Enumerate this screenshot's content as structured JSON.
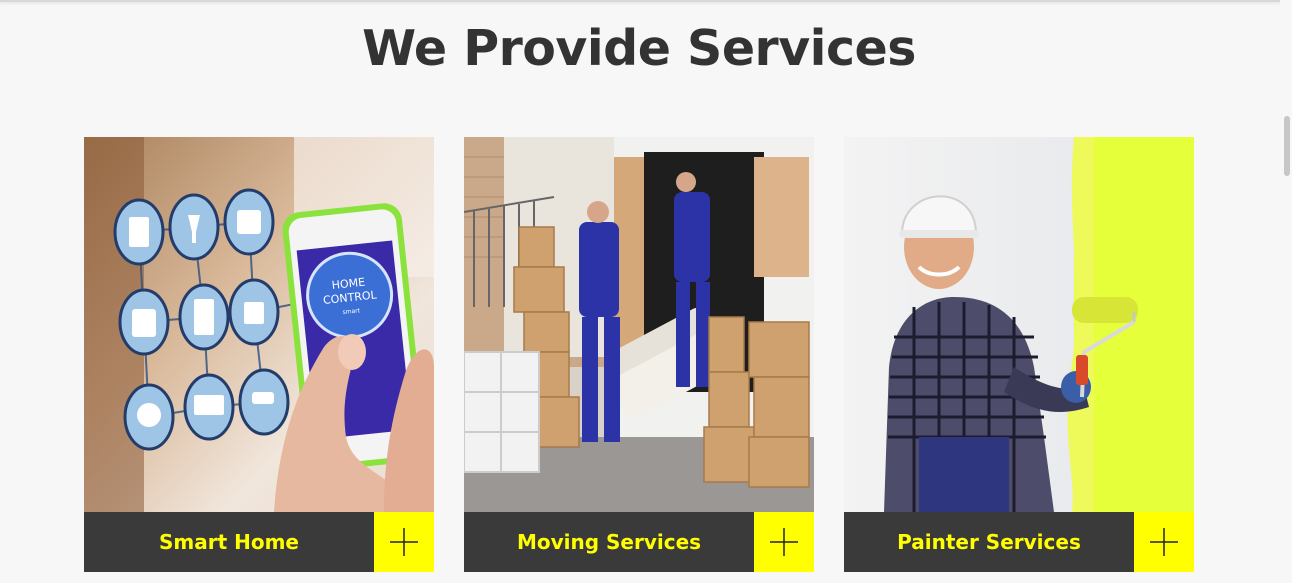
{
  "section": {
    "title": "We Provide Services"
  },
  "colors": {
    "accent": "#ffff00",
    "bar": "#3a3a3a",
    "title": "#333333",
    "background": "#f7f7f7"
  },
  "services": [
    {
      "name": "Smart Home",
      "image": "smart-home-photo",
      "action_icon": "plus-icon",
      "phone_text_1": "HOME",
      "phone_text_2": "CONTROL",
      "phone_text_3": "smart"
    },
    {
      "name": "Moving Services",
      "image": "moving-photo",
      "action_icon": "plus-icon"
    },
    {
      "name": "Painter Services",
      "image": "painter-photo",
      "action_icon": "plus-icon"
    }
  ]
}
